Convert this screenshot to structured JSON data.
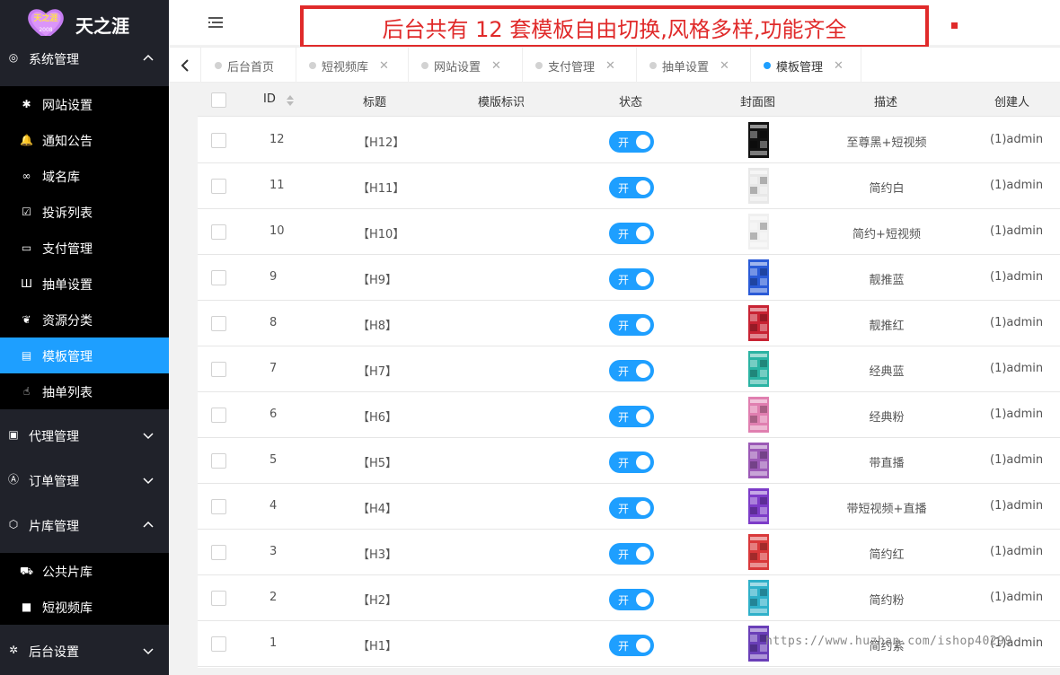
{
  "app": {
    "title": "天之涯",
    "logo_badge": "天之涯",
    "logo_badge_sub": "2008"
  },
  "banner": {
    "text": "后台共有 12 套模板自由切换,风格多样,功能齐全"
  },
  "sidebar": {
    "groups": [
      {
        "label": "系统管理",
        "icon": "settings-icon",
        "expanded": true
      },
      {
        "label": "代理管理",
        "icon": "agent-icon",
        "expanded": false
      },
      {
        "label": "订单管理",
        "icon": "order-icon",
        "expanded": false
      },
      {
        "label": "片库管理",
        "icon": "library-icon",
        "expanded": true
      },
      {
        "label": "后台设置",
        "icon": "gears-icon",
        "expanded": false
      }
    ],
    "items": [
      {
        "label": "网站设置",
        "icon": "asterisk-icon"
      },
      {
        "label": "通知公告",
        "icon": "bell-icon"
      },
      {
        "label": "域名库",
        "icon": "link-icon"
      },
      {
        "label": "投诉列表",
        "icon": "checkbox-icon"
      },
      {
        "label": "支付管理",
        "icon": "paypal-icon"
      },
      {
        "label": "抽单设置",
        "icon": "bars-icon"
      },
      {
        "label": "资源分类",
        "icon": "leaf-icon"
      },
      {
        "label": "模板管理",
        "icon": "html5-icon",
        "active": true
      },
      {
        "label": "抽单列表",
        "icon": "hand-icon"
      }
    ],
    "library_items": [
      {
        "label": "公共片库",
        "icon": "car-icon"
      },
      {
        "label": "短视频库",
        "icon": "video-icon"
      }
    ]
  },
  "tabs": [
    {
      "label": "后台首页",
      "closable": false
    },
    {
      "label": "短视频库",
      "closable": true
    },
    {
      "label": "网站设置",
      "closable": true
    },
    {
      "label": "支付管理",
      "closable": true
    },
    {
      "label": "抽单设置",
      "closable": true
    },
    {
      "label": "模板管理",
      "closable": true,
      "active": true
    }
  ],
  "table": {
    "columns": [
      "ID",
      "标题",
      "模版标识",
      "状态",
      "封面图",
      "描述",
      "创建人"
    ],
    "switch_label": "开",
    "rows": [
      {
        "id": "12",
        "title": "【H12】",
        "desc": "至尊黑+短视频",
        "creator": "(1)admin",
        "status": "on",
        "cover_color": "#111111"
      },
      {
        "id": "11",
        "title": "【H11】",
        "desc": "简约白",
        "creator": "(1)admin",
        "status": "on",
        "cover_color": "#e8e8e8"
      },
      {
        "id": "10",
        "title": "【H10】",
        "desc": "简约+短视频",
        "creator": "(1)admin",
        "status": "on",
        "cover_color": "#f0f0f0"
      },
      {
        "id": "9",
        "title": "【H9】",
        "desc": "靓推蓝",
        "creator": "(1)admin",
        "status": "on",
        "cover_color": "#2a5bd7"
      },
      {
        "id": "8",
        "title": "【H8】",
        "desc": "靓推红",
        "creator": "(1)admin",
        "status": "on",
        "cover_color": "#c82333"
      },
      {
        "id": "7",
        "title": "【H7】",
        "desc": "经典蓝",
        "creator": "(1)admin",
        "status": "on",
        "cover_color": "#2bb3a3"
      },
      {
        "id": "6",
        "title": "【H6】",
        "desc": "经典粉",
        "creator": "(1)admin",
        "status": "on",
        "cover_color": "#e07fb0"
      },
      {
        "id": "5",
        "title": "【H5】",
        "desc": "带直播",
        "creator": "(1)admin",
        "status": "on",
        "cover_color": "#9b59b6"
      },
      {
        "id": "4",
        "title": "【H4】",
        "desc": "带短视频+直播",
        "creator": "(1)admin",
        "status": "on",
        "cover_color": "#7d3cc8"
      },
      {
        "id": "3",
        "title": "【H3】",
        "desc": "简约红",
        "creator": "(1)admin",
        "status": "on",
        "cover_color": "#d9383a"
      },
      {
        "id": "2",
        "title": "【H2】",
        "desc": "简约粉",
        "creator": "(1)admin",
        "status": "on",
        "cover_color": "#2fb0c9"
      },
      {
        "id": "1",
        "title": "【H1】",
        "desc": "简约紫",
        "creator": "(1)admin",
        "status": "on",
        "cover_color": "#6a3fb8"
      }
    ]
  },
  "watermark": "https://www.huzhan.com/ishop40299",
  "colors": {
    "sidebar_bg": "#20222a",
    "sub_bg": "#000000",
    "accent": "#1e9fff",
    "banner_red": "#e02a2a"
  }
}
